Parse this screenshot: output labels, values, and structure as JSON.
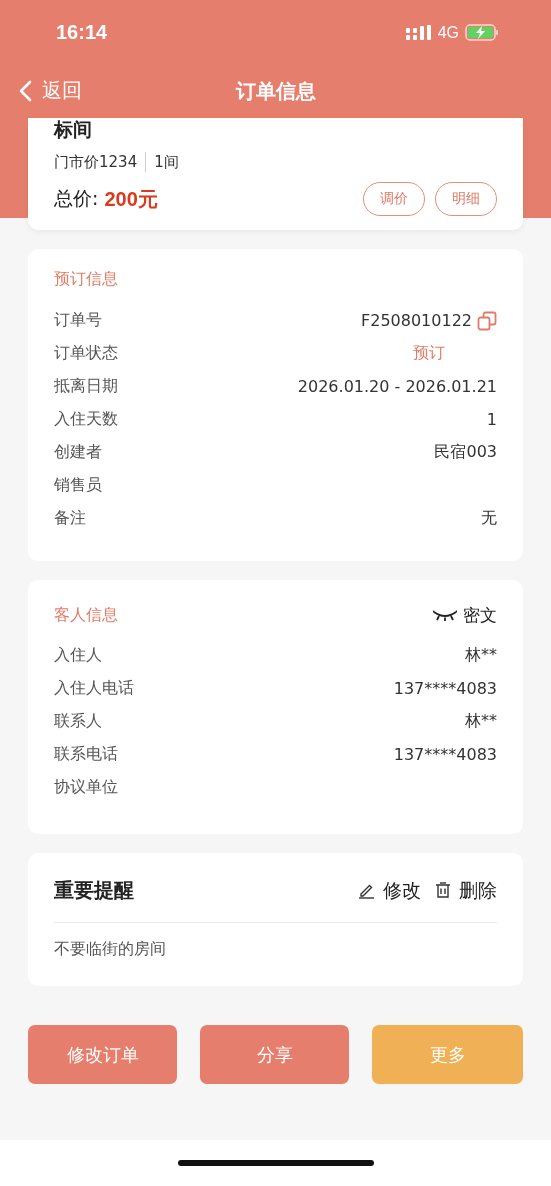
{
  "status_bar": {
    "time": "16:14",
    "network": "4G"
  },
  "nav": {
    "back": "返回",
    "title": "订单信息"
  },
  "room": {
    "name": "标间",
    "rack_price": "门市价1234",
    "rooms": "1间",
    "total_label": "总价:",
    "total": "200元",
    "buttons": [
      "调价",
      "明细"
    ]
  },
  "booking": {
    "title": "预订信息",
    "rows": [
      {
        "label": "订单号",
        "value": "F2508010122",
        "kind": "copy"
      },
      {
        "label": "订单状态",
        "value": "预订",
        "kind": "status"
      },
      {
        "label": "抵离日期",
        "value": "2026.01.20 - 2026.01.21",
        "kind": "plain"
      },
      {
        "label": "入住天数",
        "value": "1",
        "kind": "plain"
      },
      {
        "label": "创建者",
        "value": "民宿003",
        "kind": "plain"
      },
      {
        "label": "销售员"
      },
      {
        "label": "备注",
        "value": "无",
        "kind": "plain"
      }
    ]
  },
  "guest": {
    "title": "客人信息",
    "toggle": "密文",
    "rows": [
      {
        "label": "入住人",
        "value": "林**"
      },
      {
        "label": "入住人电话",
        "value": "137****4083"
      },
      {
        "label": "联系人",
        "value": "林**"
      },
      {
        "label": "联系电话",
        "value": "137****4083"
      },
      {
        "label": "协议单位"
      }
    ]
  },
  "reminder": {
    "title": "重要提醒",
    "edit": "修改",
    "delete": "删除",
    "text": "不要临街的房间"
  },
  "actions": [
    {
      "label": "修改订单",
      "kind": "primary"
    },
    {
      "label": "分享",
      "kind": "primary"
    },
    {
      "label": "更多",
      "kind": "secondary"
    }
  ]
}
